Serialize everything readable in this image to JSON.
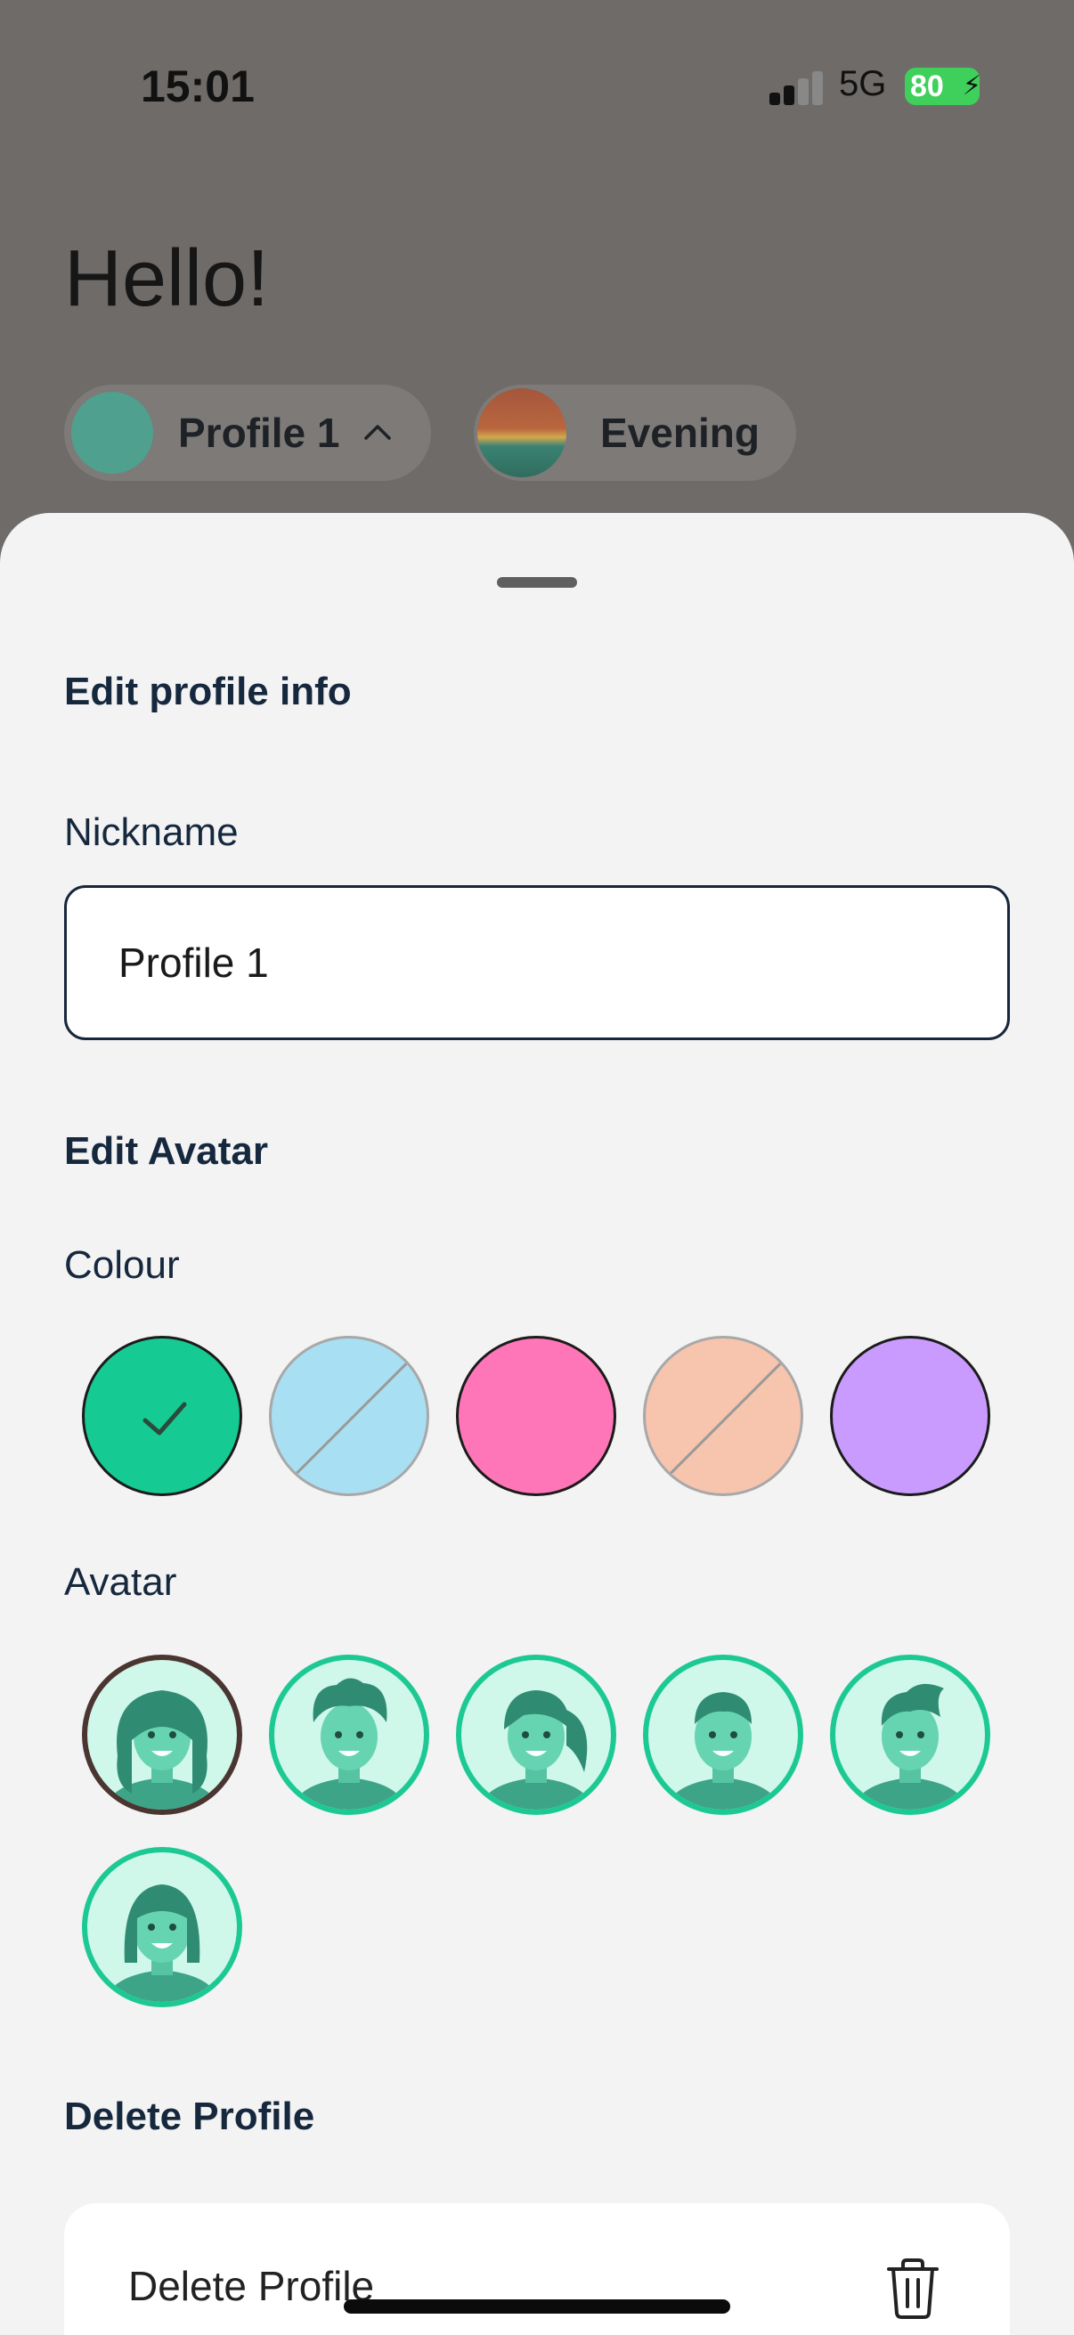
{
  "status_bar": {
    "time": "15:01",
    "network": "5G",
    "battery": "80"
  },
  "header": {
    "greeting": "Hello!"
  },
  "chips": {
    "profile_label": "Profile 1",
    "time_label": "Evening"
  },
  "sheet": {
    "edit_info_title": "Edit profile info",
    "nickname_label": "Nickname",
    "nickname_value": "Profile 1",
    "edit_avatar_title": "Edit Avatar",
    "colour_label": "Colour",
    "colours": [
      {
        "hex": "#15cb93",
        "selected": true,
        "available": true
      },
      {
        "hex": "#a8dff3",
        "selected": false,
        "available": false
      },
      {
        "hex": "#ff76b8",
        "selected": false,
        "available": true
      },
      {
        "hex": "#f7c4ae",
        "selected": false,
        "available": false
      },
      {
        "hex": "#c99bff",
        "selected": false,
        "available": true
      }
    ],
    "avatar_label": "Avatar",
    "avatars": [
      {
        "name": "avatar-long-hair",
        "selected": true
      },
      {
        "name": "avatar-curly-hair",
        "selected": false
      },
      {
        "name": "avatar-ponytail",
        "selected": false
      },
      {
        "name": "avatar-short-hair",
        "selected": false
      },
      {
        "name": "avatar-quiff",
        "selected": false
      },
      {
        "name": "avatar-bob",
        "selected": false
      }
    ],
    "delete_title": "Delete Profile",
    "delete_label": "Delete Profile"
  },
  "icons": {
    "trash": "trash-icon",
    "check": "check-icon",
    "chevron": "chevron-up-icon"
  }
}
